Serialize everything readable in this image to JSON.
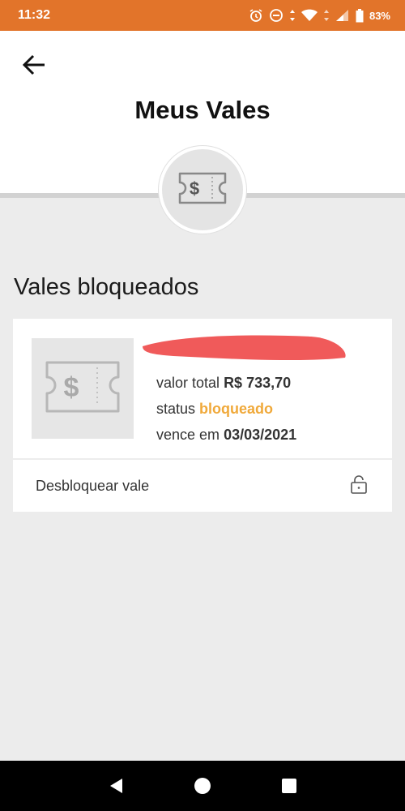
{
  "status_bar": {
    "time": "11:32",
    "battery": "83%"
  },
  "header": {
    "title": "Meus Vales",
    "back_icon": "arrow-left-icon"
  },
  "section": {
    "title": "Vales bloqueados"
  },
  "voucher": {
    "total_label": "valor total",
    "total_value": "R$ 733,70",
    "status_label": "status",
    "status_value": "bloqueado",
    "due_label": "vence em",
    "due_value": "03/03/2021",
    "status_color": "#f0a93a"
  },
  "action": {
    "unlock_label": "Desbloquear vale",
    "unlock_icon": "lock-icon"
  },
  "colors": {
    "status_bar": "#e2742a",
    "redaction": "#f05a5a"
  }
}
